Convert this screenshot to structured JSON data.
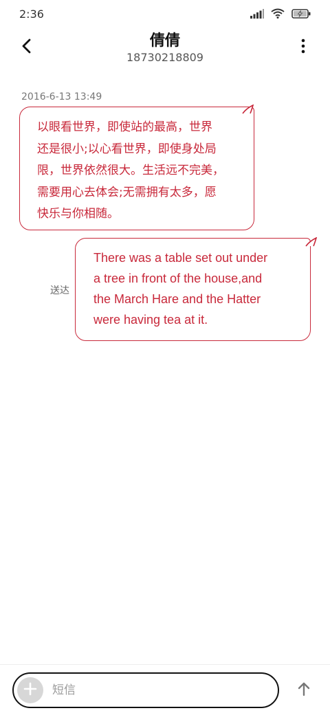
{
  "status_bar": {
    "time": "2:36",
    "icons": [
      "signal-icon",
      "wifi-icon",
      "battery-charging-icon"
    ]
  },
  "header": {
    "contact_name": "倩倩",
    "contact_number": "18730218809",
    "icons": {
      "back": "back-arrow-icon",
      "more": "more-vertical-icon"
    }
  },
  "messages": {
    "timestamp": "2016-6-13 13:49",
    "incoming": {
      "lines": [
        "以眼看世界，即使站的最高，世界",
        "还是很小;以心看世界，即使身处局",
        "限，世界依然很大。生活远不完美，",
        "需要用心去体会;无需拥有太多，愿",
        "快乐与你相随。"
      ]
    },
    "outgoing": {
      "lines": [
        "There was a table set out under",
        "a tree in front of the house,and",
        "the March Hare and the Hatter",
        "were having tea at it."
      ],
      "status": "送达"
    }
  },
  "composer": {
    "placeholder": "短信",
    "value": "",
    "icons": {
      "add": "plus-icon",
      "send": "send-arrow-icon"
    }
  },
  "colors": {
    "accent": "#c8283a",
    "background": "#ffffff",
    "pill_border": "#111111",
    "add_button_bg": "#d7d7d7"
  }
}
